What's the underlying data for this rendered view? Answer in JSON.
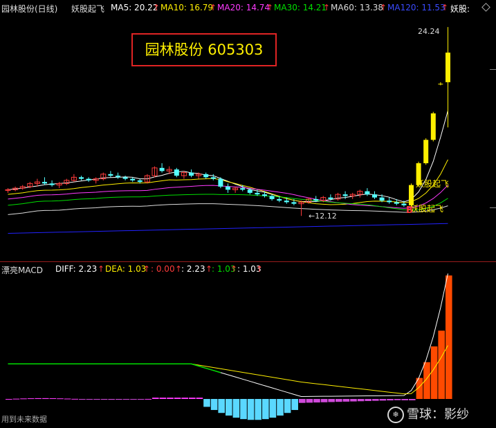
{
  "header": {
    "stock": "园林股份(日线)",
    "indicator": "妖股起飞",
    "ma5": "MA5: 20.22",
    "ma10": "MA10: 16.79",
    "ma20": "MA20: 14.74",
    "ma30": "MA30: 14.21",
    "ma60": "MA60: 13.38",
    "ma120": "MA120: 11.53",
    "tail": "妖股:",
    "arrow": "↑"
  },
  "stock_box": "园林股份 605303",
  "macd_header": {
    "name": "漂亮MACD",
    "diff": "DIFF: 2.23",
    "dea": "DEA: 1.03",
    "v1": ": 0.00",
    "v2": ": 2.23",
    "v3": ": 1.03",
    "v4": ": 1.03",
    "arrow": "↑"
  },
  "annotations": {
    "high": "24.24",
    "low": "12.12",
    "signal1": "妖股起飞",
    "signal2": "妖股起飞",
    "b_mark": "B"
  },
  "footer": {
    "note": "用到未来数据",
    "watermark": "雪球：影纱",
    "wm_icon": "❄"
  },
  "colors": {
    "up": "#ff3b3b",
    "down": "#54ffff",
    "signal": "#ffef00",
    "ma5": "#ffffff",
    "ma10": "#ffef00",
    "ma20": "#ff3bff",
    "ma30": "#00e000",
    "ma60": "#dcdcdc",
    "ma120": "#2222ff"
  },
  "chart_data": [
    {
      "type": "candlestick",
      "title": "园林股份(日线)",
      "ylim": [
        10,
        25
      ],
      "candles": [
        [
          13.8,
          13.9,
          13.6,
          13.8
        ],
        [
          13.8,
          14.0,
          13.7,
          13.9
        ],
        [
          13.9,
          14.1,
          13.8,
          14.0
        ],
        [
          14.0,
          14.3,
          13.9,
          14.2
        ],
        [
          14.2,
          14.5,
          14.0,
          14.3
        ],
        [
          14.3,
          14.6,
          14.1,
          14.2
        ],
        [
          14.2,
          14.4,
          14.0,
          14.1
        ],
        [
          14.1,
          14.3,
          13.9,
          14.2
        ],
        [
          14.2,
          14.5,
          14.1,
          14.4
        ],
        [
          14.4,
          14.8,
          14.3,
          14.6
        ],
        [
          14.6,
          14.7,
          14.4,
          14.5
        ],
        [
          14.5,
          14.6,
          14.3,
          14.4
        ],
        [
          14.4,
          14.6,
          14.2,
          14.5
        ],
        [
          14.5,
          14.9,
          14.4,
          14.8
        ],
        [
          14.8,
          15.0,
          14.6,
          14.7
        ],
        [
          14.7,
          14.9,
          14.5,
          14.6
        ],
        [
          14.6,
          14.7,
          14.4,
          14.5
        ],
        [
          14.5,
          14.6,
          14.3,
          14.4
        ],
        [
          14.4,
          14.5,
          14.2,
          14.3
        ],
        [
          14.3,
          14.8,
          14.2,
          14.7
        ],
        [
          14.7,
          15.3,
          14.6,
          15.2
        ],
        [
          15.2,
          15.5,
          14.9,
          15.0
        ],
        [
          15.0,
          15.3,
          14.8,
          15.1
        ],
        [
          15.1,
          15.2,
          14.6,
          14.7
        ],
        [
          14.7,
          15.0,
          14.5,
          14.9
        ],
        [
          14.9,
          15.1,
          14.6,
          14.7
        ],
        [
          14.7,
          14.9,
          14.5,
          14.8
        ],
        [
          14.8,
          14.9,
          14.5,
          14.6
        ],
        [
          14.6,
          14.8,
          14.4,
          14.5
        ],
        [
          14.5,
          14.6,
          13.9,
          14.0
        ],
        [
          14.0,
          14.2,
          13.6,
          13.8
        ],
        [
          13.8,
          14.0,
          13.6,
          13.9
        ],
        [
          13.9,
          14.1,
          13.7,
          13.8
        ],
        [
          13.8,
          13.9,
          13.5,
          13.6
        ],
        [
          13.6,
          13.8,
          13.4,
          13.5
        ],
        [
          13.5,
          13.7,
          13.3,
          13.4
        ],
        [
          13.4,
          13.5,
          13.1,
          13.2
        ],
        [
          13.2,
          13.4,
          13.0,
          13.1
        ],
        [
          13.1,
          13.3,
          12.9,
          13.0
        ],
        [
          13.0,
          13.2,
          12.8,
          12.9
        ],
        [
          12.9,
          13.1,
          12.12,
          13.0
        ],
        [
          13.0,
          13.3,
          12.9,
          13.2
        ],
        [
          13.2,
          13.4,
          13.0,
          13.1
        ],
        [
          13.1,
          13.4,
          13.0,
          13.3
        ],
        [
          13.3,
          13.5,
          13.1,
          13.2
        ],
        [
          13.2,
          13.6,
          13.1,
          13.5
        ],
        [
          13.5,
          13.7,
          13.2,
          13.4
        ],
        [
          13.4,
          13.6,
          13.2,
          13.5
        ],
        [
          13.5,
          13.8,
          13.3,
          13.7
        ],
        [
          13.7,
          13.9,
          13.4,
          13.5
        ],
        [
          13.5,
          13.7,
          13.2,
          13.3
        ],
        [
          13.3,
          13.5,
          13.0,
          13.1
        ],
        [
          13.1,
          13.3,
          12.9,
          13.0
        ],
        [
          13.0,
          13.2,
          12.8,
          12.9
        ],
        [
          12.9,
          13.1,
          12.7,
          12.8
        ],
        [
          12.8,
          14.2,
          12.7,
          14.1
        ],
        [
          14.1,
          15.6,
          14.0,
          15.5
        ],
        [
          15.5,
          17.1,
          15.4,
          17.0
        ],
        [
          17.0,
          18.8,
          16.9,
          18.7
        ],
        [
          20.6,
          20.7,
          20.5,
          20.6
        ],
        [
          20.7,
          24.24,
          17.8,
          22.6
        ]
      ],
      "ma": [
        "MA5",
        "MA10",
        "MA20",
        "MA30",
        "MA60",
        "MA120"
      ]
    },
    {
      "type": "bar",
      "title": "漂亮MACD",
      "series": [
        {
          "name": "DIFF",
          "last": 2.23
        },
        {
          "name": "DEA",
          "last": 1.03
        }
      ]
    }
  ]
}
